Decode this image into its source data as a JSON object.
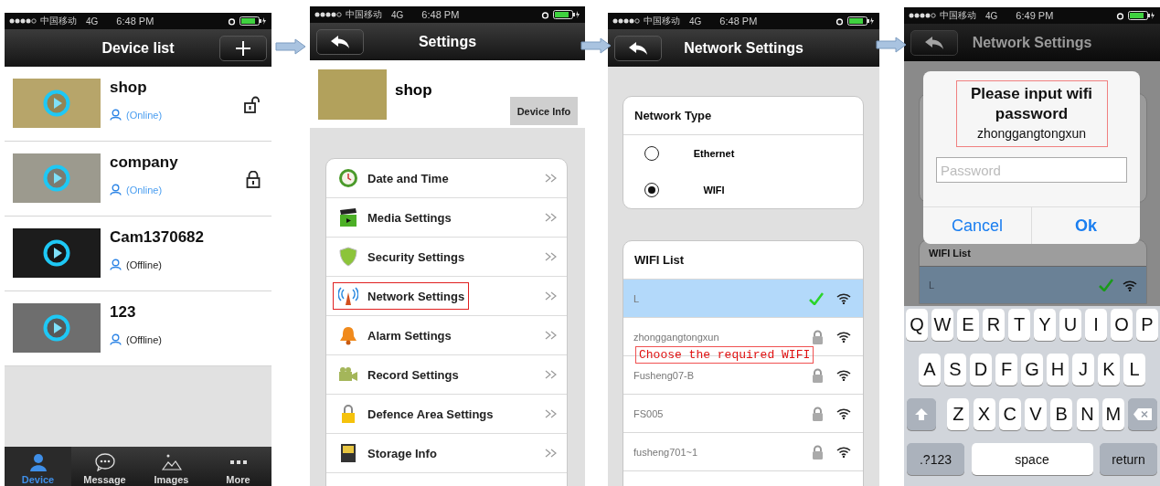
{
  "screens": [
    {
      "kind": "device_list",
      "status_bar": {
        "carrier": "中国移动",
        "network": "4G",
        "time": "6:48 PM"
      },
      "title": "Device list",
      "devices": [
        {
          "name": "shop",
          "status": "(Online)",
          "online": true,
          "locked": false
        },
        {
          "name": "company",
          "status": "(Online)",
          "online": true,
          "locked": true
        },
        {
          "name": "Cam1370682",
          "status": "(Offline)",
          "online": false
        },
        {
          "name": "123",
          "status": "(Offline)",
          "online": false
        }
      ],
      "tab_bar": [
        {
          "kind": "person",
          "label": "Device",
          "selected": true
        },
        {
          "kind": "chat",
          "label": "Message",
          "selected": false
        },
        {
          "kind": "image",
          "label": "Images",
          "selected": false
        },
        {
          "kind": "more",
          "label": "More",
          "selected": false
        }
      ]
    },
    {
      "kind": "settings",
      "status_bar": {
        "carrier": "中国移动",
        "network": "4G",
        "time": "6:48 PM"
      },
      "title": "Settings",
      "device_name": "shop",
      "device_info_button": "Device Info",
      "items": [
        {
          "kind": "clock",
          "label": "Date and Time",
          "highlighted": false
        },
        {
          "kind": "clapper",
          "label": "Media Settings",
          "highlighted": false
        },
        {
          "kind": "shield",
          "label": "Security Settings",
          "highlighted": false
        },
        {
          "kind": "antenna",
          "label": "Network Settings",
          "highlighted": true
        },
        {
          "kind": "bell",
          "label": "Alarm Settings",
          "highlighted": false
        },
        {
          "kind": "camera",
          "label": "Record Settings",
          "highlighted": false
        },
        {
          "kind": "padlock",
          "label": "Defence Area Settings",
          "highlighted": false
        },
        {
          "kind": "storage",
          "label": "Storage Info",
          "highlighted": false
        }
      ]
    },
    {
      "kind": "network",
      "status_bar": {
        "carrier": "中国移动",
        "network": "4G",
        "time": "6:48 PM"
      },
      "title": "Network Settings",
      "network_type": {
        "title": "Network Type",
        "options": [
          {
            "label": "Ethernet",
            "selected": false
          },
          {
            "label": "WIFI",
            "selected": true
          }
        ]
      },
      "wifi_list": {
        "title": "WIFI List",
        "networks": [
          {
            "name": "L",
            "selected": true,
            "connected": true,
            "locked": false
          },
          {
            "name": "zhonggangtongxun",
            "selected": false,
            "connected": false,
            "locked": true
          },
          {
            "name": "Fusheng07-B",
            "selected": false,
            "connected": false,
            "locked": true
          },
          {
            "name": "FS005",
            "selected": false,
            "connected": false,
            "locked": true
          },
          {
            "name": "fusheng701~1",
            "selected": false,
            "connected": false,
            "locked": true
          }
        ]
      },
      "annotation": "Choose the required WIFI"
    },
    {
      "kind": "password_prompt",
      "status_bar": {
        "carrier": "中国移动",
        "network": "4G",
        "time": "6:49 PM"
      },
      "title": "Network Settings",
      "background_list": {
        "title": "WIFI List",
        "networks": [
          {
            "name": "L",
            "connected": true
          }
        ]
      },
      "dialog": {
        "title": "Please input wifi password",
        "ssid": "zhonggangtongxun",
        "placeholder": "Password",
        "cancel_button": "Cancel",
        "ok_button": "Ok"
      },
      "keyboard": {
        "rows": [
          [
            "Q",
            "W",
            "E",
            "R",
            "T",
            "Y",
            "U",
            "I",
            "O",
            "P"
          ],
          [
            "A",
            "S",
            "D",
            "F",
            "G",
            "H",
            "J",
            "K",
            "L"
          ],
          [
            "Z",
            "X",
            "C",
            "V",
            "B",
            "N",
            "M"
          ]
        ],
        "mode_key": ".?123",
        "space_key": "space",
        "return_key": "return"
      }
    }
  ]
}
